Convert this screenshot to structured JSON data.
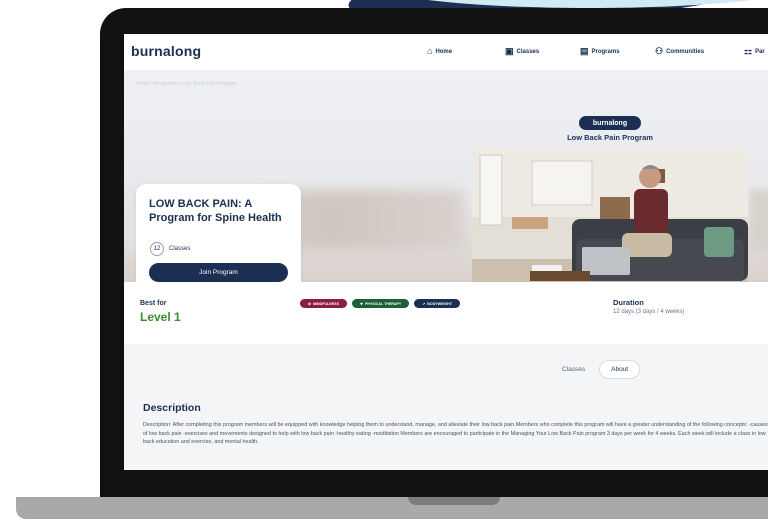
{
  "nav": {
    "logo": "burnalong",
    "items": [
      {
        "label": "Home",
        "icon": "home-icon"
      },
      {
        "label": "Classes",
        "icon": "classes-icon"
      },
      {
        "label": "Programs",
        "icon": "programs-icon"
      },
      {
        "label": "Communities",
        "icon": "communities-icon"
      },
      {
        "label": "Par",
        "icon": "partners-icon"
      }
    ]
  },
  "hero": {
    "breadcrumb": "Home  >  Programs  >  Low Back Pain Program",
    "card_title": "LOW BACK PAIN: A Program for Spine Health",
    "class_count": "12",
    "class_label": "Classes",
    "join_label": "Join Program",
    "brand_badge": "burnalong",
    "program_subtitle": "Low Back Pain Program"
  },
  "info": {
    "best_for_label": "Best for",
    "level": "Level 1",
    "tags": [
      {
        "label": "MINDFULNESS",
        "color": "#8b1e3a"
      },
      {
        "label": "PHYSICAL THERAPY",
        "color": "#1d5e3b"
      },
      {
        "label": "BODYWEIGHT",
        "color": "#1b2f52"
      }
    ],
    "duration_label": "Duration",
    "duration_value": "12 days (3 days / 4 weeks)"
  },
  "content": {
    "tabs": [
      {
        "label": "Classes",
        "active": false
      },
      {
        "label": "About",
        "active": true
      }
    ],
    "description_heading": "Description",
    "description_text": "Description: After completing this program members will be equipped with knowledge helping them to understand, manage, and alleviate their low back pain.Members who complete this program will have a greater understanding of the following concepts: -causes of low back pain -exercises and movements designed to help with low back pain -healthy eating -meditation Members are encouraged to participate in the Managing Your Low Back Pain program 3 days per week for 4 weeks. Each week will include a class in low back education and exercise, and mental health."
  },
  "colors": {
    "brand_navy": "#1b2f52",
    "level_green": "#3d8a34"
  }
}
